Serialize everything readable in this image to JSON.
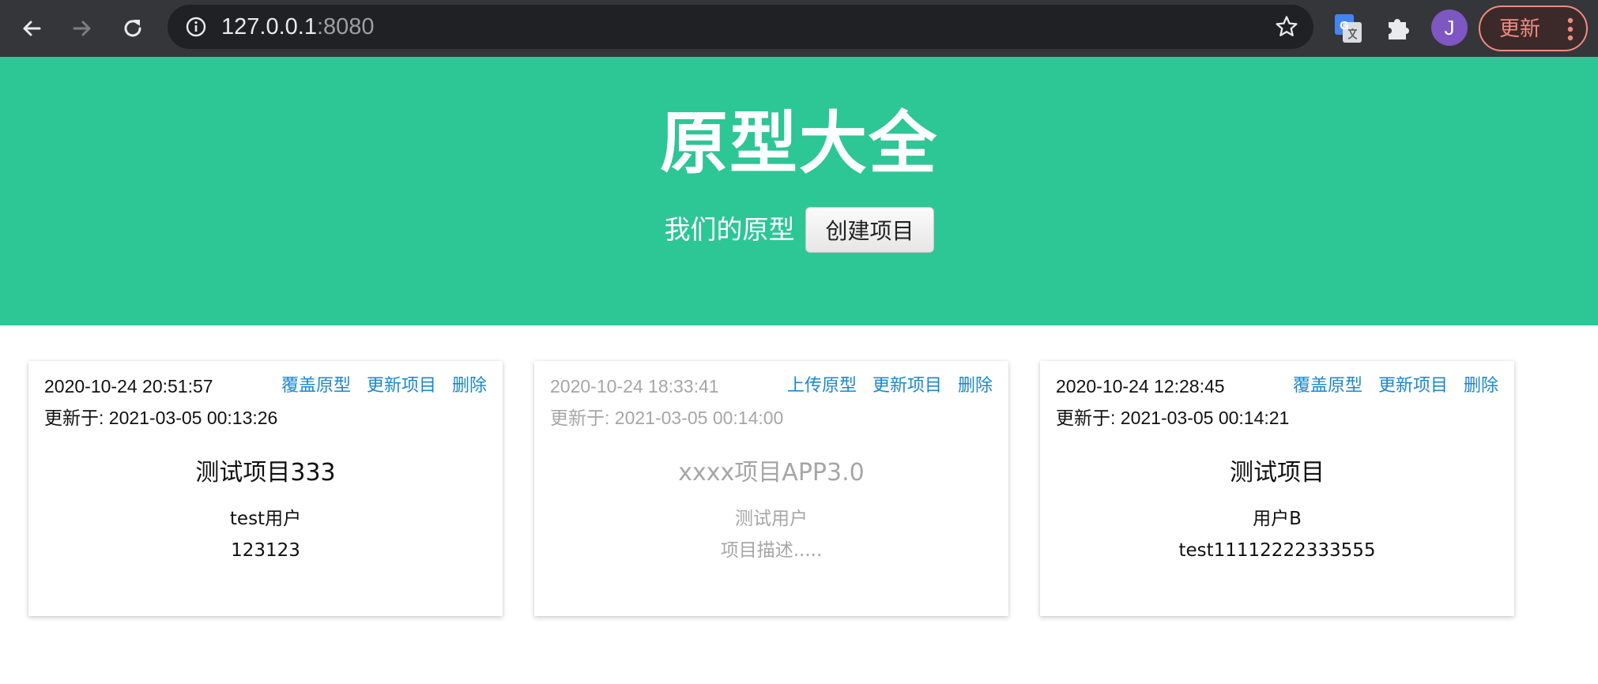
{
  "browser": {
    "url_host": "127.0.0.1",
    "url_port": ":8080",
    "avatar_letter": "J",
    "update_label": "更新"
  },
  "hero": {
    "title": "原型大全",
    "subtitle": "我们的原型",
    "create_button": "创建项目"
  },
  "colors": {
    "hero_bg": "#2dc695",
    "link": "#1a87d0",
    "muted_text": "#a6a6a6"
  },
  "projects": [
    {
      "created": "2020-10-24 20:51:57",
      "actions": [
        "覆盖原型",
        "更新项目",
        "删除"
      ],
      "updated": "更新于: 2021-03-05 00:13:26",
      "name": "测试项目333",
      "user": "test用户",
      "description": "123123",
      "muted": false
    },
    {
      "created": "2020-10-24 18:33:41",
      "actions": [
        "上传原型",
        "更新项目",
        "删除"
      ],
      "updated": "更新于: 2021-03-05 00:14:00",
      "name": "xxxx项目APP3.0",
      "user": "测试用户",
      "description": "项目描述.....",
      "muted": true
    },
    {
      "created": "2020-10-24 12:28:45",
      "actions": [
        "覆盖原型",
        "更新项目",
        "删除"
      ],
      "updated": "更新于: 2021-03-05 00:14:21",
      "name": "测试项目",
      "user": "用户B",
      "description": "test11112222333555",
      "muted": false
    }
  ]
}
